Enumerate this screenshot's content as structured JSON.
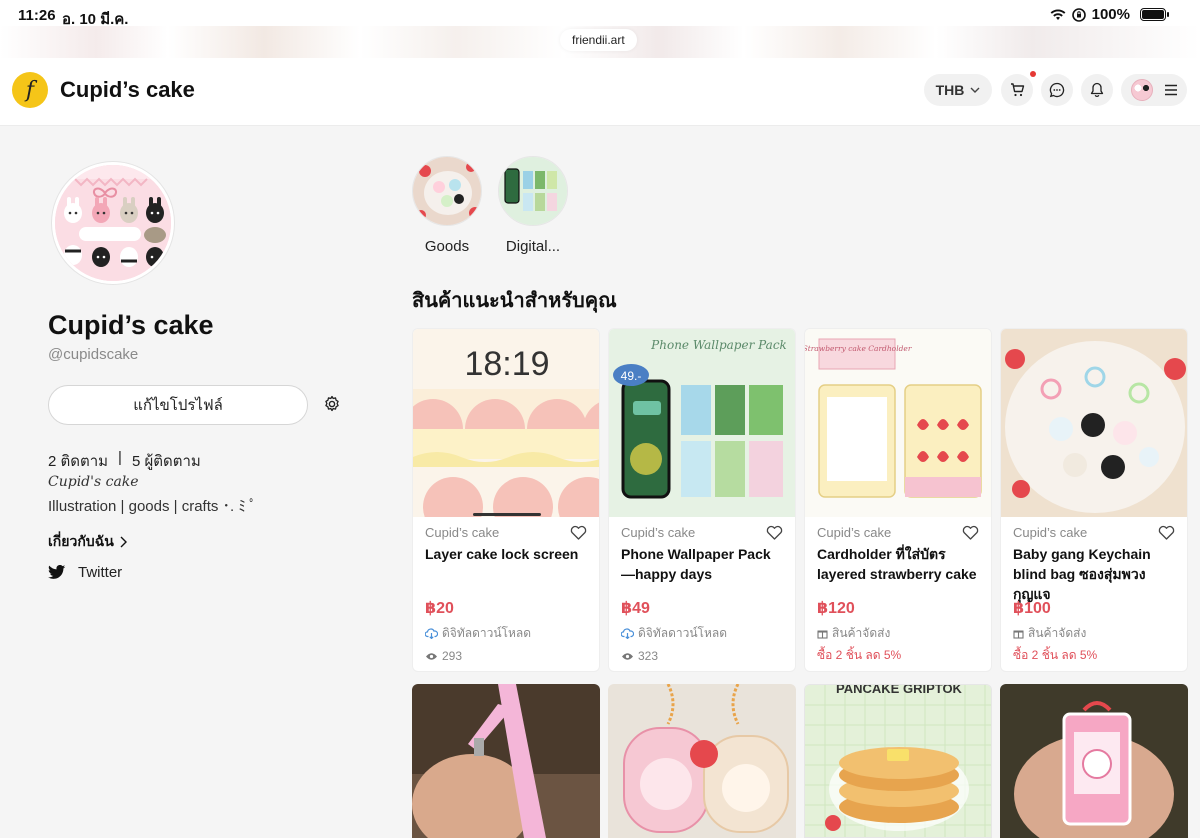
{
  "status": {
    "time": "11:26",
    "date": "อ. 10 มี.ค.",
    "battery": "100%"
  },
  "browser": {
    "url": "friendii.art"
  },
  "header": {
    "shop_name": "Cupid’s cake",
    "currency": "THB",
    "logo_letter": "f"
  },
  "profile": {
    "name": "Cupid’s cake",
    "handle": "@cupidscake",
    "edit_button": "แก้ไขโปรไฟล์",
    "following": "2 ติดตาม",
    "separator": "|",
    "followers": "5 ผู้ติดตาม",
    "bio_title": "Cupid's cake",
    "bio": "Illustration | goods | crafts ･. ﾐ ﾟ",
    "about_link": "เกี่ยวกับฉัน",
    "twitter": "Twitter"
  },
  "categories": [
    {
      "label": "Goods"
    },
    {
      "label": "Digital..."
    }
  ],
  "section_title": "สินค้าแนะนำสำหรับคุณ",
  "products": [
    {
      "seller": "Cupid’s cake",
      "name": "Layer cake lock screen",
      "price": "฿20",
      "type": "ดิจิทัลดาวน์โหลด",
      "views": "293",
      "lock_time": "18:19"
    },
    {
      "seller": "Cupid’s cake",
      "name": "Phone Wallpaper Pack—happy days",
      "price": "฿49",
      "type": "ดิจิทัลดาวน์โหลด",
      "views": "323",
      "banner": "Phone Wallpaper Pack",
      "badge": "49.-"
    },
    {
      "seller": "Cupid’s cake",
      "name": "Cardholder ที่ใส่บัตร layered strawberry cake",
      "price": "฿120",
      "type": "สินค้าจัดส่ง",
      "promo": "ซื้อ 2 ชิ้น ลด 5%",
      "banner": "Strawberry cake Cardholder"
    },
    {
      "seller": "Cupid’s cake",
      "name": "Baby gang Keychain blind bag ซองสุ่มพวงกุญแจ",
      "price": "฿100",
      "type": "สินค้าจัดส่ง",
      "promo": "ซื้อ 2 ชิ้น ลด 5%"
    }
  ],
  "bottom_banner": "PANCAKE GRIPTOK",
  "colors": {
    "accent": "#e0505a",
    "logo": "#f5c518"
  }
}
